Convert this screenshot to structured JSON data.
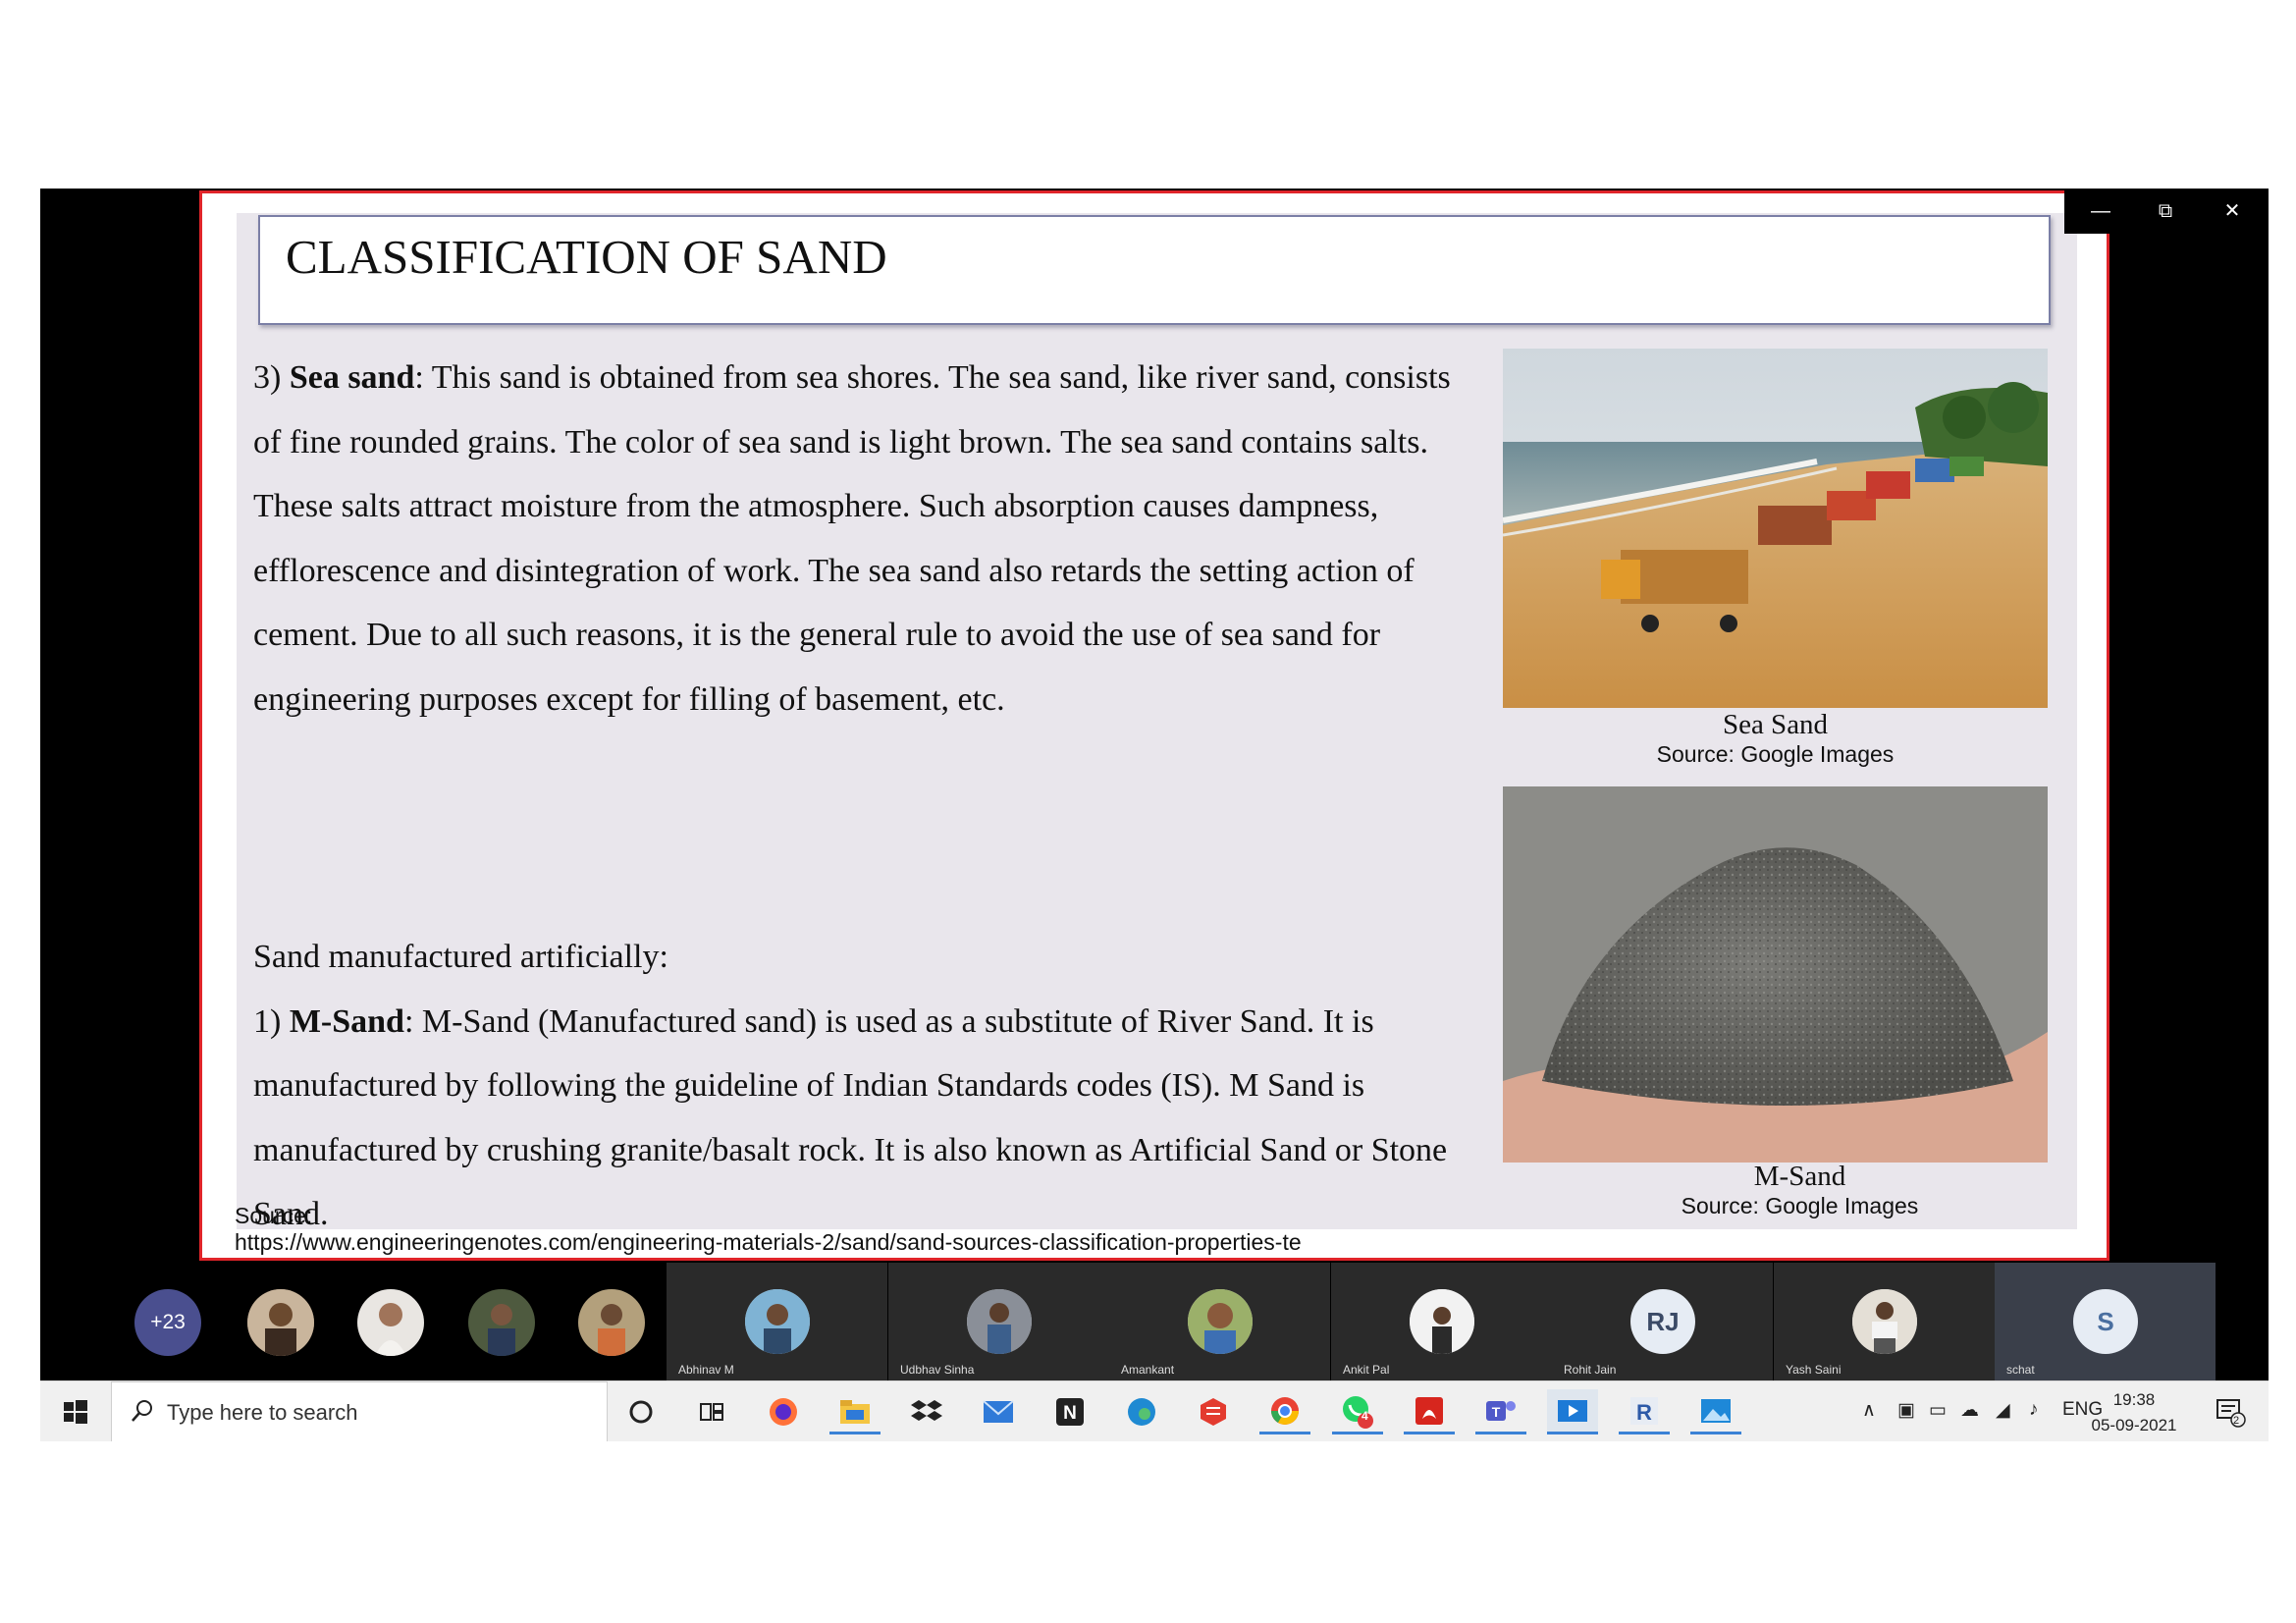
{
  "slide": {
    "title": "CLASSIFICATION OF SAND",
    "para1": {
      "prefix": "3) ",
      "bold": "Sea sand",
      "text": ": This sand is obtained from sea shores. The sea sand, like river sand, consists of fine rounded grains. The color of sea sand is light brown. The sea sand contains salts. These salts attract moisture from the atmosphere. Such absorption causes dampness, efflorescence and disintegration of work. The sea sand also retards the setting action of cement. Due to all such reasons, it is the general rule to avoid the use of sea sand for engineering purposes except for filling of basement, etc."
    },
    "para2": {
      "heading": "Sand manufactured artificially:",
      "prefix": "1) ",
      "bold": "M-Sand",
      "text": ": M-Sand (Manufactured sand) is used as a substitute of River Sand. It is manufactured by following the guideline of Indian Standards codes (IS). M Sand is manufactured by crushing granite/basalt rock. It is also known as Artificial Sand or Stone Sand."
    },
    "image1": {
      "caption": "Sea Sand",
      "source": "Source: Google Images"
    },
    "image2": {
      "caption": "M-Sand",
      "source": "Source: Google Images"
    },
    "source_label": "Source:",
    "source_url": "https://www.engineeringenotes.com/engineering-materials-2/sand/sand-sources-classification-properties-te"
  },
  "meeting": {
    "more_count": "+23",
    "participants": [
      {
        "name": "Abhinav M"
      },
      {
        "name": "Udbhav Sinha"
      },
      {
        "name": "Amankant"
      },
      {
        "name": "Ankit Pal"
      },
      {
        "name": "Rohit Jain",
        "initials": "RJ"
      },
      {
        "name": "Yash Saini"
      },
      {
        "name": "schat",
        "initials": "S"
      }
    ]
  },
  "taskbar": {
    "search_placeholder": "Type here to search",
    "lang": "ENG",
    "time": "19:38",
    "date": "05-09-2021",
    "notification_count": "2",
    "whatsapp_badge": "4"
  },
  "colors": {
    "slide_border": "#e0252a",
    "title_border": "#7b7fa6",
    "teams_purple": "#4a4f8f",
    "taskbar_accent": "#3b82d6"
  }
}
